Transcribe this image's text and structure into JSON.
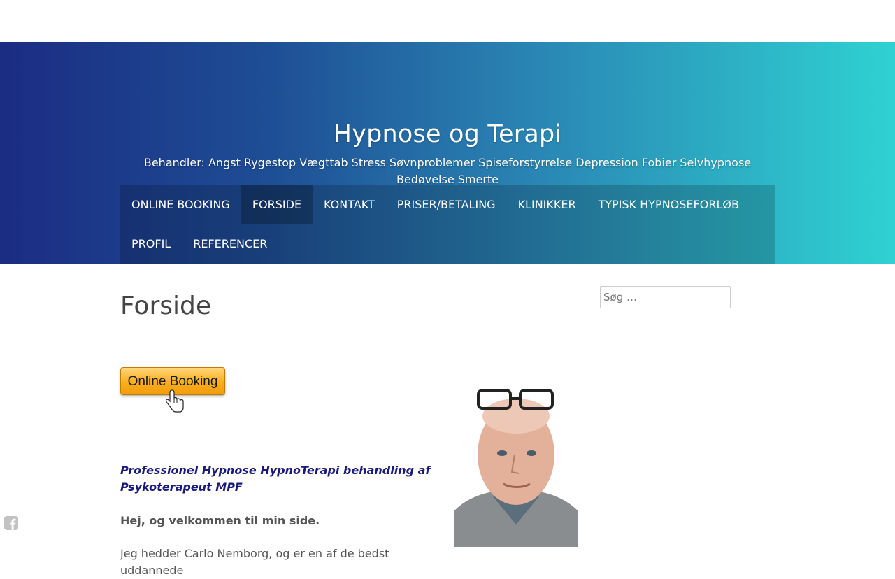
{
  "header": {
    "site_title": "Hypnose og Terapi",
    "site_description": "Behandler: Angst Rygestop Vægttab Stress Søvnproblemer Spiseforstyrrelse Depression Fobier Selvhypnose Bedøvelse Smerte"
  },
  "nav": {
    "items": [
      {
        "label": "ONLINE BOOKING",
        "active": false
      },
      {
        "label": "FORSIDE",
        "active": true
      },
      {
        "label": "KONTAKT",
        "active": false
      },
      {
        "label": "PRISER/BETALING",
        "active": false
      },
      {
        "label": "KLINIKKER",
        "active": false
      },
      {
        "label": "TYPISK HYPNOSEFORLØB",
        "active": false
      },
      {
        "label": "PROFIL",
        "active": false
      },
      {
        "label": "REFERENCER",
        "active": false
      }
    ]
  },
  "main": {
    "page_title": "Forside",
    "booking_button_label": "Online Booking",
    "lead": "Professionel Hypnose HypnoTerapi behandling af Psykoterapeut MPF",
    "greeting": "Hej, og velkommen til min side.",
    "body_text": "Jeg hedder Carlo Nemborg, og er en af de bedst uddannede"
  },
  "sidebar": {
    "search_placeholder": "Søg …"
  },
  "icons": {
    "facebook": "facebook-icon",
    "cursor": "hand-pointer-icon"
  },
  "colors": {
    "header_gradient_start": "#1b2c82",
    "header_gradient_end": "#2fd2d2",
    "lead_text": "#1a1a7a",
    "booking_button": "#f9ae1c"
  }
}
